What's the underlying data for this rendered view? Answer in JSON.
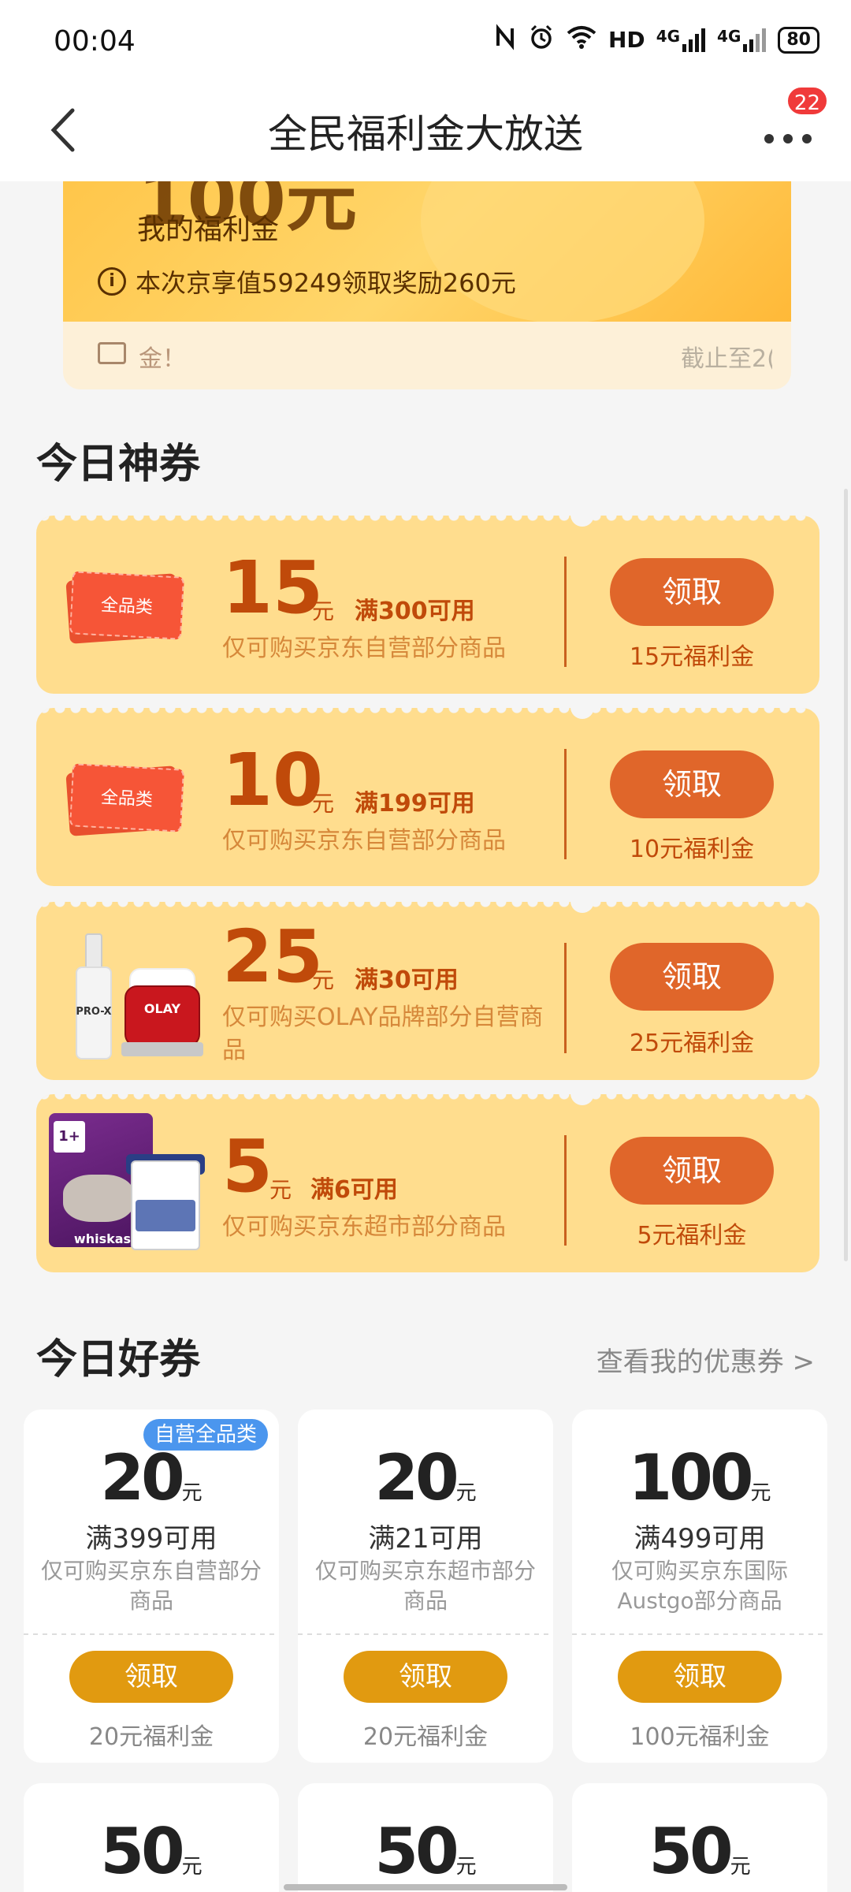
{
  "status_bar": {
    "time": "00:04",
    "icons": [
      "nfc-icon",
      "alarm-icon",
      "wifi-icon",
      "hd-icon",
      "signal-4g-icon",
      "signal-4g-icon"
    ],
    "hd_label": "HD",
    "net1": "4G",
    "net2": "4G",
    "battery": "80"
  },
  "nav": {
    "title": "全民福利金大放送",
    "badge_count": "22"
  },
  "hero": {
    "amount_partial": "100元",
    "label": "我的福利金",
    "info": "本次京享值59249领取奖励260元",
    "footer_msg": "金！",
    "footer_deadline": "截止至2("
  },
  "section1": {
    "title": "今日神券"
  },
  "coupons": [
    {
      "tag": "全品类",
      "amount": "15",
      "yuan": "元",
      "condition": "满300可用",
      "desc": "仅可购买京东自营部分商品",
      "button": "领取",
      "reward": "15元福利金"
    },
    {
      "tag": "全品类",
      "amount": "10",
      "yuan": "元",
      "condition": "满199可用",
      "desc": "仅可购买京东自营部分商品",
      "button": "领取",
      "reward": "10元福利金"
    },
    {
      "tag": "",
      "amount": "25",
      "yuan": "元",
      "condition": "满30可用",
      "desc": "仅可购买OLAY品牌部分自营商品",
      "button": "领取",
      "reward": "25元福利金",
      "product_text_1": "PRO-X",
      "product_text_2": "OLAY"
    },
    {
      "tag": "",
      "amount": "5",
      "yuan": "元",
      "condition": "满6可用",
      "desc": "仅可购买京东超市部分商品",
      "button": "领取",
      "reward": "5元福利金",
      "product_text_1": "whiskas",
      "product_text_2": "1+"
    }
  ],
  "section2": {
    "title": "今日好券",
    "link": "查看我的优惠券 >"
  },
  "good_coupons": [
    {
      "badge": "自营全品类",
      "amount": "20",
      "yuan": "元",
      "condition": "满399可用",
      "desc": "仅可购买京东自营部分商品",
      "button": "领取",
      "reward": "20元福利金"
    },
    {
      "badge": "",
      "amount": "20",
      "yuan": "元",
      "condition": "满21可用",
      "desc": "仅可购买京东超市部分商品",
      "button": "领取",
      "reward": "20元福利金"
    },
    {
      "badge": "",
      "amount": "100",
      "yuan": "元",
      "condition": "满499可用",
      "desc": "仅可购买京东国际Austgo部分商品",
      "button": "领取",
      "reward": "100元福利金"
    }
  ],
  "partial_coupons": [
    {
      "amount": "50",
      "yuan": "元"
    },
    {
      "amount": "50",
      "yuan": "元"
    },
    {
      "amount": "50",
      "yuan": "元"
    }
  ],
  "colors": {
    "coupon_bg": "#ffdd8e",
    "coupon_text": "#c04a0a",
    "claim_button": "#e0662a",
    "good_claim_button": "#e19a10",
    "badge_blue": "#4b96ee"
  }
}
